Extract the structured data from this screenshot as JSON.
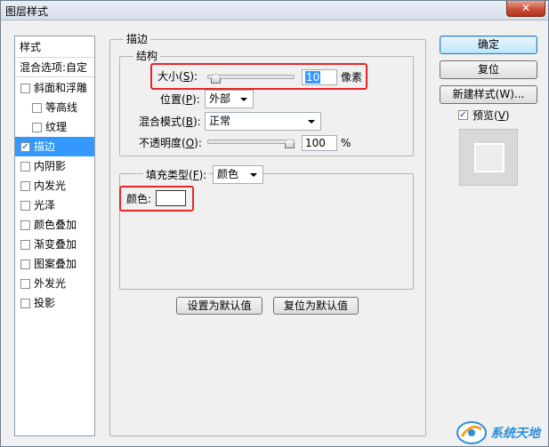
{
  "window": {
    "title": "图层样式",
    "close_glyph": "✕"
  },
  "style_list": {
    "header": "样式",
    "blend_options": "混合选项:自定",
    "items": [
      {
        "label": "斜面和浮雕",
        "checked": false,
        "indent": false,
        "selected": false
      },
      {
        "label": "等高线",
        "checked": false,
        "indent": true,
        "selected": false
      },
      {
        "label": "纹理",
        "checked": false,
        "indent": true,
        "selected": false
      },
      {
        "label": "描边",
        "checked": true,
        "indent": false,
        "selected": true
      },
      {
        "label": "内阴影",
        "checked": false,
        "indent": false,
        "selected": false
      },
      {
        "label": "内发光",
        "checked": false,
        "indent": false,
        "selected": false
      },
      {
        "label": "光泽",
        "checked": false,
        "indent": false,
        "selected": false
      },
      {
        "label": "颜色叠加",
        "checked": false,
        "indent": false,
        "selected": false
      },
      {
        "label": "渐变叠加",
        "checked": false,
        "indent": false,
        "selected": false
      },
      {
        "label": "图案叠加",
        "checked": false,
        "indent": false,
        "selected": false
      },
      {
        "label": "外发光",
        "checked": false,
        "indent": false,
        "selected": false
      },
      {
        "label": "投影",
        "checked": false,
        "indent": false,
        "selected": false
      }
    ]
  },
  "stroke": {
    "title": "描边",
    "structure": {
      "title": "结构",
      "size": {
        "label": "大小",
        "mnemonic": "S",
        "value": "10",
        "unit": "像素",
        "slider_fraction": 0.05
      },
      "position": {
        "label": "位置",
        "mnemonic": "P",
        "value": "外部"
      },
      "blend_mode": {
        "label": "混合模式",
        "mnemonic": "B",
        "value": "正常"
      },
      "opacity": {
        "label": "不透明度",
        "mnemonic": "O",
        "value": "100",
        "unit": "%",
        "slider_fraction": 1.0
      }
    },
    "fill": {
      "label": "填充类型",
      "mnemonic": "F",
      "value": "颜色",
      "color_label": "颜色:",
      "color_hex": "#ffffff"
    },
    "set_default": "设置为默认值",
    "reset_default": "复位为默认值"
  },
  "buttons": {
    "ok": "确定",
    "reset": "复位",
    "new_style": "新建样式(W)...",
    "preview_label": "预览",
    "preview_mnemonic": "V",
    "preview_checked": true
  },
  "watermark": {
    "text": "系统天地"
  },
  "icons": {
    "checkbox_checked": "checkmark-icon",
    "dropdown": "chevron-down-icon",
    "slider": "slider-thumb-icon"
  }
}
